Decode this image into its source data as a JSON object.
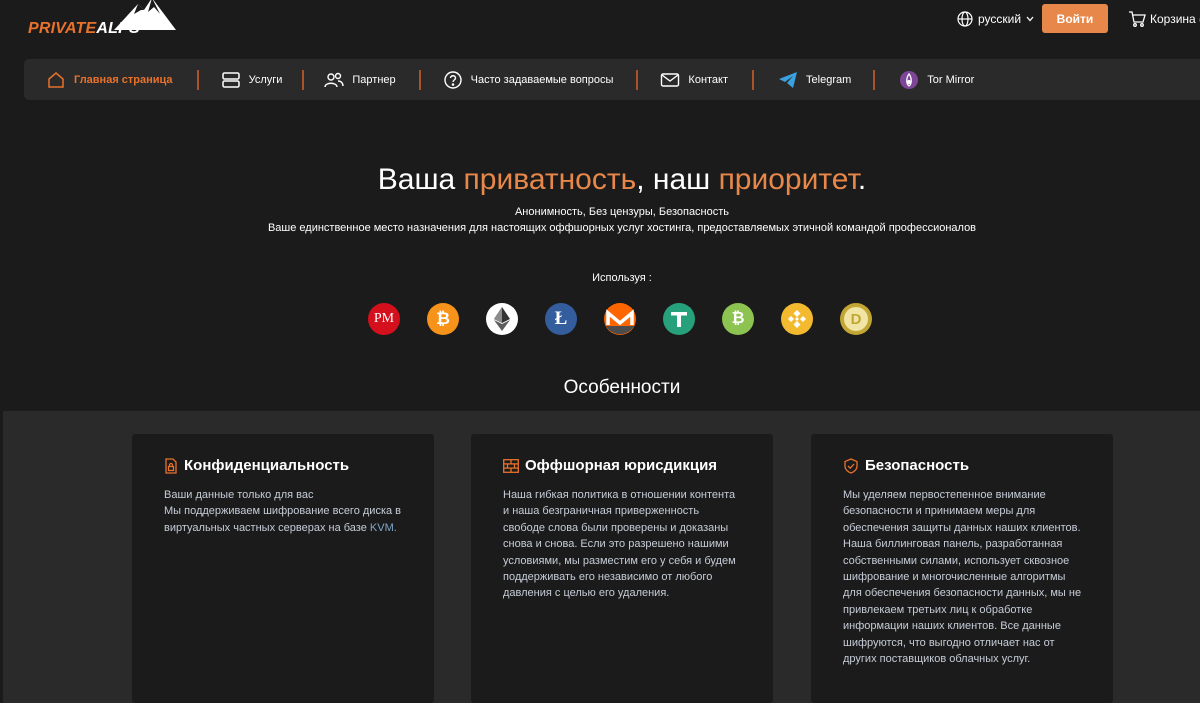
{
  "header": {
    "logo_part1": "PRIVATE",
    "logo_part2": "ALPS",
    "language": "русский",
    "login_label": "Войти",
    "cart_label": "Корзина ("
  },
  "nav": {
    "items": [
      {
        "label": "Главная страница",
        "icon": "home-icon"
      },
      {
        "label": "Услуги",
        "icon": "server-icon"
      },
      {
        "label": "Партнер",
        "icon": "users-icon"
      },
      {
        "label": "Часто задаваемые вопросы",
        "icon": "question-icon"
      },
      {
        "label": "Контакт",
        "icon": "mail-icon"
      },
      {
        "label": "Telegram",
        "icon": "telegram-icon"
      },
      {
        "label": "Tor Mirror",
        "icon": "tor-icon"
      }
    ]
  },
  "hero": {
    "title_part1": "Ваша ",
    "title_highlight1": "приватность",
    "title_part2": ", наш ",
    "title_highlight2": "приоритет",
    "title_part3": ".",
    "subtitle1": "Анонимность, Без цензуры, Безопасность",
    "subtitle2": "Ваше единственное место назначения для настоящих оффшорных услуг хостинга, предоставляемых этичной командой профессионалов",
    "using_label": "Используя :"
  },
  "payment_methods": [
    {
      "name": "perfect-money",
      "label": "PM"
    },
    {
      "name": "bitcoin"
    },
    {
      "name": "ethereum"
    },
    {
      "name": "litecoin"
    },
    {
      "name": "monero"
    },
    {
      "name": "tether"
    },
    {
      "name": "bitcoin-cash"
    },
    {
      "name": "binance"
    },
    {
      "name": "dogecoin"
    }
  ],
  "features": {
    "title": "Особенности",
    "cards": [
      {
        "title": "Конфиденциальность",
        "icon": "lock-file-icon",
        "line1": "Ваши данные только для вас",
        "line2": "Мы поддерживаем шифрование всего диска в виртуальных частных серверах на базе ",
        "kvm": "KVM."
      },
      {
        "title": "Оффшорная юрисдикция",
        "icon": "brick-wall-icon",
        "text": "Наша гибкая политика в отношении контента и наша безграничная приверженность свободе слова были проверены и доказаны снова и снова. Если это разрешено нашими условиями, мы разместим его у себя и будем поддерживать его независимо от любого давления с целью его удаления."
      },
      {
        "title": "Безопасность",
        "icon": "shield-check-icon",
        "text": "Мы уделяем первостепенное внимание безопасности и принимаем меры для обеспечения защиты данных наших клиентов. Наша биллинговая панель, разработанная собственными силами, использует сквозное шифрование и многочисленные алгоритмы для обеспечения безопасности данных, мы не привлекаем третьих лиц к обработке информации наших клиентов. Все данные шифруются, что выгодно отличает нас от других поставщиков облачных услуг."
      }
    ]
  },
  "colors": {
    "accent": "#e8722c",
    "button": "#e8874a",
    "background": "#1b1b1b",
    "panel": "#2a2a2a"
  }
}
